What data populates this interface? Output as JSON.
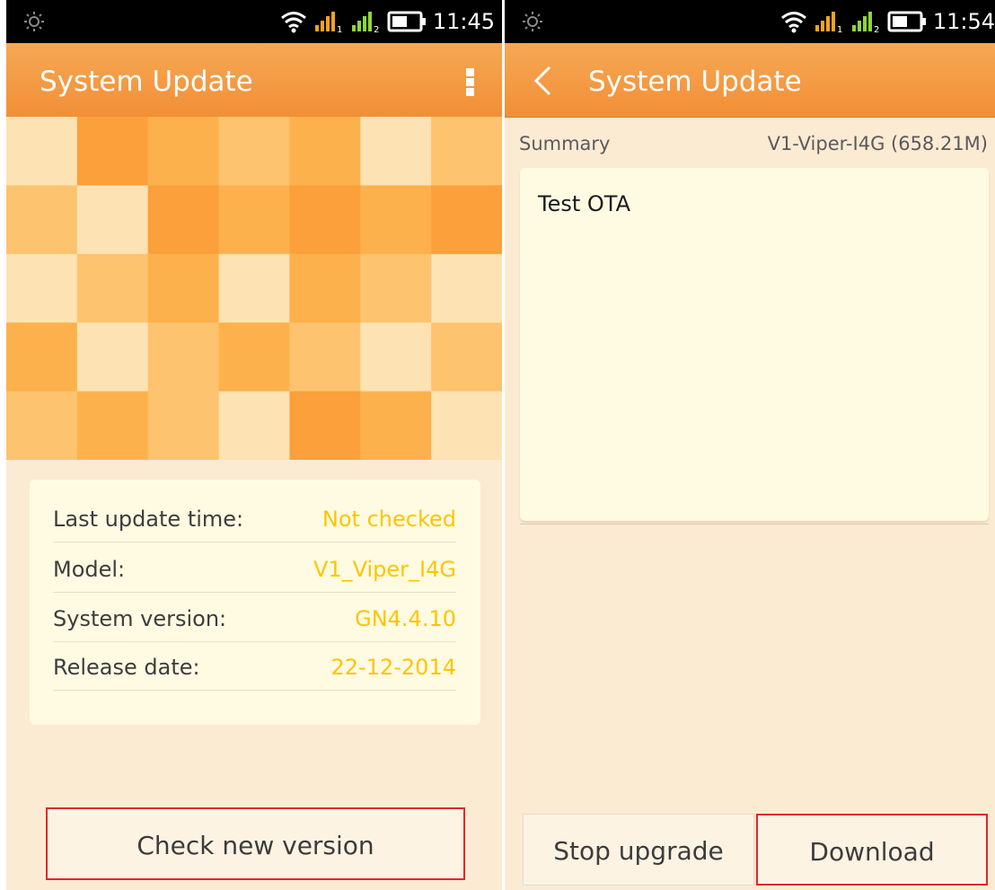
{
  "left_screen": {
    "status_bar": {
      "time": "11:45",
      "icons": [
        "brightness-icon",
        "wifi-icon",
        "signal-sim1-icon",
        "signal-sim2-icon",
        "battery-icon"
      ]
    },
    "action_bar": {
      "title": "System Update",
      "menu_icon": "overflow-menu-icon"
    },
    "info": {
      "rows": [
        {
          "label": "Last update time:",
          "value": "Not checked"
        },
        {
          "label": "Model:",
          "value": "V1_Viper_I4G"
        },
        {
          "label": "System version:",
          "value": "GN4.4.10"
        },
        {
          "label": "Release date:",
          "value": "22-12-2014"
        }
      ]
    },
    "check_button": "Check new version"
  },
  "right_screen": {
    "status_bar": {
      "time": "11:54",
      "icons": [
        "brightness-icon",
        "wifi-icon",
        "signal-sim1-icon",
        "signal-sim2-icon",
        "battery-icon"
      ]
    },
    "action_bar": {
      "title": "System Update",
      "back_icon": "back-chevron-icon"
    },
    "summary": {
      "label": "Summary",
      "value": "V1-Viper-I4G (658.21M)"
    },
    "release_notes": "Test OTA",
    "stop_button": "Stop upgrade",
    "download_button": "Download"
  },
  "colors": {
    "action_bar": "#f39a40",
    "page_background": "#fcebd3",
    "card_background": "#fffbe2",
    "value_text": "#ffc400",
    "highlight_border": "#e0282c"
  }
}
